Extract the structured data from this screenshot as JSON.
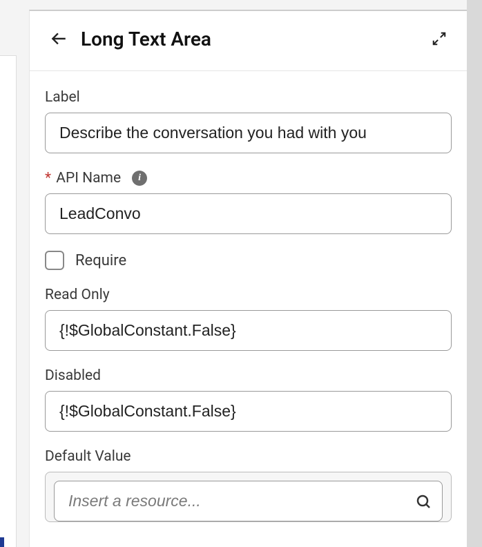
{
  "header": {
    "title": "Long Text Area"
  },
  "fields": {
    "label": {
      "label": "Label",
      "value": "Describe the conversation you had with you"
    },
    "apiName": {
      "label": "API Name",
      "value": "LeadConvo",
      "required": true
    },
    "require": {
      "label": "Require",
      "checked": false
    },
    "readOnly": {
      "label": "Read Only",
      "value": "{!$GlobalConstant.False}"
    },
    "disabled": {
      "label": "Disabled",
      "value": "{!$GlobalConstant.False}"
    },
    "defaultValue": {
      "label": "Default Value",
      "placeholder": "Insert a resource..."
    }
  }
}
